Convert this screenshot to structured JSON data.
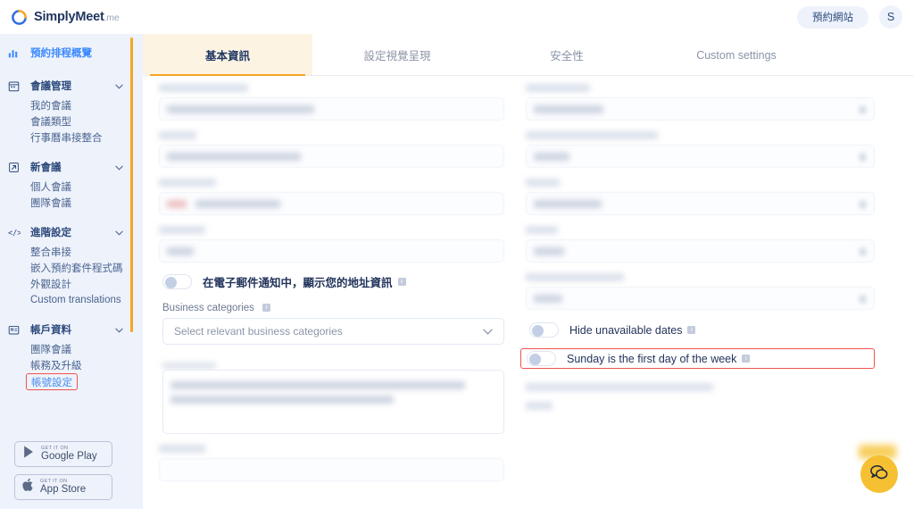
{
  "brand": {
    "name_strong": "SimplyMeet",
    "suffix": ".me",
    "logo_icon": "circular-arc-logo"
  },
  "topbar": {
    "book_site_label": "預約網站",
    "avatar_initial": "S"
  },
  "sidebar": {
    "overview": {
      "label": "預約排程概覽",
      "icon": "bar-chart-icon"
    },
    "sections": [
      {
        "label": "會議管理",
        "icon": "calendar-icon",
        "chevron": "chevron-down-icon",
        "items": [
          {
            "label": "我的會議"
          },
          {
            "label": "會議類型"
          },
          {
            "label": "行事曆串接整合"
          }
        ]
      },
      {
        "label": "新會議",
        "icon": "external-link-icon",
        "chevron": "chevron-down-icon",
        "items": [
          {
            "label": "個人會議"
          },
          {
            "label": "團隊會議"
          }
        ]
      },
      {
        "label": "進階設定",
        "icon": "code-icon",
        "chevron": "chevron-down-icon",
        "items": [
          {
            "label": "整合串接"
          },
          {
            "label": "嵌入預約套件程式碼"
          },
          {
            "label": "外觀設計"
          },
          {
            "label": "Custom translations"
          }
        ]
      },
      {
        "label": "帳戶資料",
        "icon": "id-card-icon",
        "chevron": "chevron-down-icon",
        "items": [
          {
            "label": "團隊會議"
          },
          {
            "label": "帳務及升級"
          },
          {
            "label": "帳號設定",
            "highlighted": true
          }
        ]
      }
    ],
    "store_badges": [
      {
        "small": "GET IT ON",
        "big": "Google Play",
        "icon": "google-play-icon"
      },
      {
        "small": "GET IT ON",
        "big": "App Store",
        "icon": "apple-icon"
      }
    ]
  },
  "tabs": [
    {
      "label": "基本資訊",
      "active": true
    },
    {
      "label": "設定視覺呈現",
      "active": false
    },
    {
      "label": "安全性",
      "active": false
    },
    {
      "label": "Custom settings",
      "active": false
    }
  ],
  "left_column": {
    "address_toggle": {
      "label": "在電子郵件通知中，顯示您的地址資訊",
      "info_icon": "info-icon",
      "on": false
    },
    "business_categories": {
      "label": "Business categories",
      "info_icon": "info-icon",
      "placeholder": "Select relevant business categories",
      "value": "",
      "chevron": "chevron-down-icon"
    }
  },
  "right_column": {
    "hide_unavailable": {
      "label": "Hide unavailable dates",
      "info_icon": "info-icon",
      "on": false
    },
    "sunday_first": {
      "label": "Sunday is the first day of the week",
      "info_icon": "info-icon",
      "on": false,
      "highlighted": true
    }
  },
  "chat": {
    "icon": "chat-bubble-icon"
  },
  "colors": {
    "accent_orange": "#f5a623",
    "highlight_red": "#f0534f",
    "sidebar_bg": "#eef2fb",
    "active_tab_bg": "#fdf3e3",
    "link_blue": "#3d8bfd",
    "chat_yellow": "#f5c132"
  }
}
